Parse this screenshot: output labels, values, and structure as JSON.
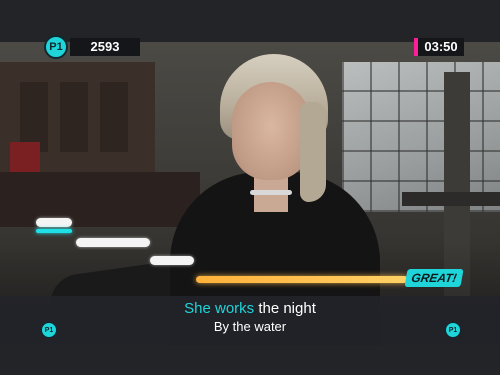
{
  "hud": {
    "player_label": "P1",
    "score": "2593",
    "timer": "03:50",
    "accent_color": "#1fd5d9",
    "timer_accent_color": "#ff1e9a"
  },
  "feedback": {
    "rating": "GREAT!"
  },
  "lyrics": {
    "current_sung": "She works",
    "current_rest": " the night",
    "next_line": "By the water",
    "left_marker": "P1",
    "right_marker": "P1"
  }
}
